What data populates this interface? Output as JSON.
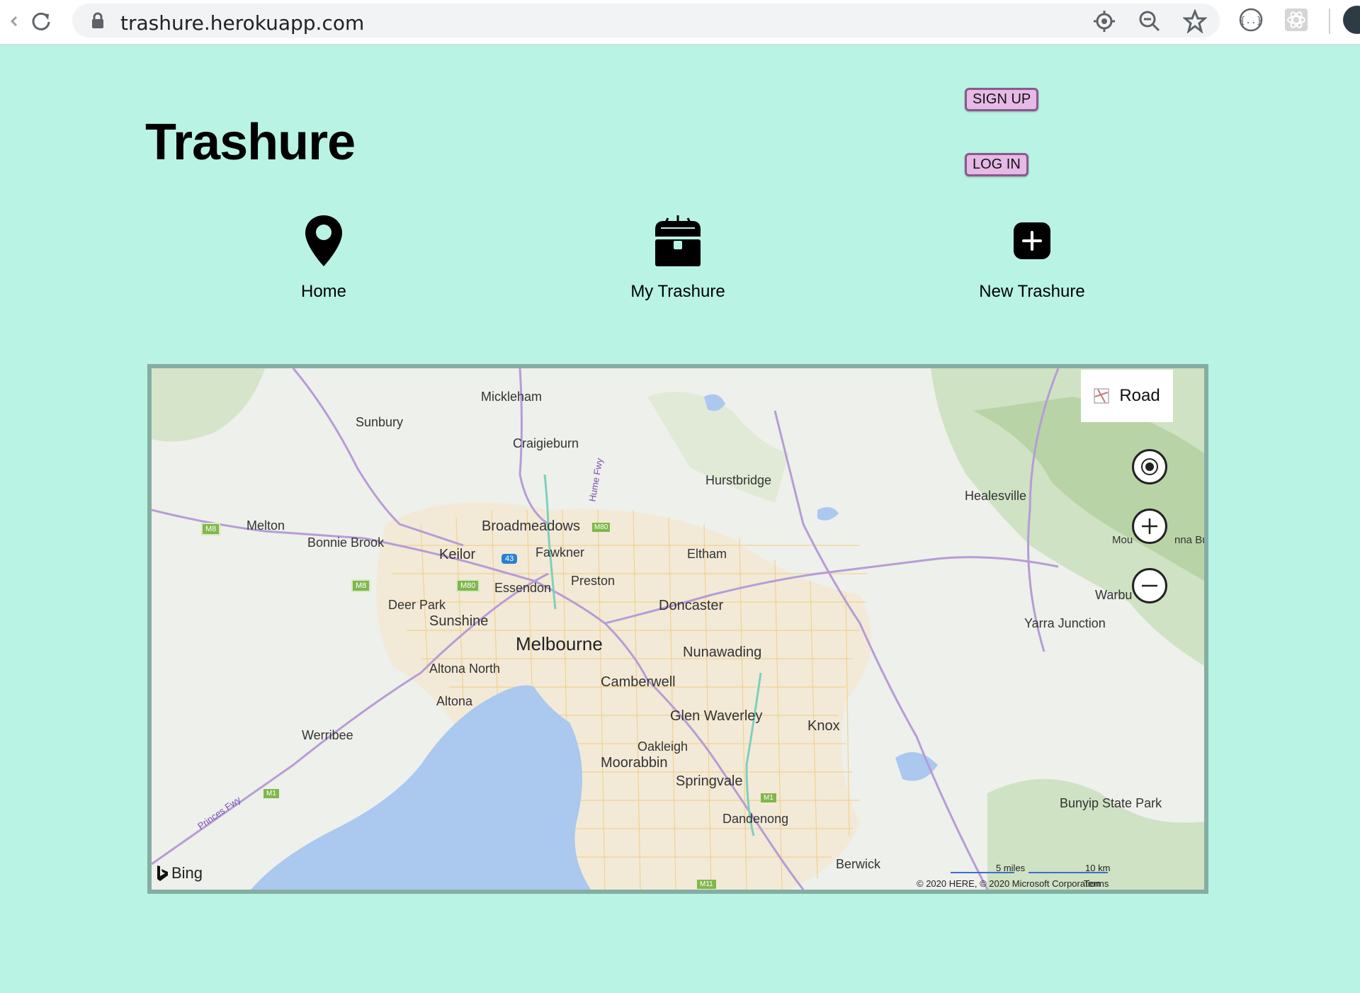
{
  "browser": {
    "url": "trashure.herokuapp.com"
  },
  "header": {
    "title": "Trashure",
    "signup_label": "SIGN UP",
    "login_label": "LOG IN"
  },
  "nav": {
    "items": [
      {
        "label": "Home",
        "icon": "map-pin-icon"
      },
      {
        "label": "My Trashure",
        "icon": "treasure-chest-icon"
      },
      {
        "label": "New Trashure",
        "icon": "plus-square-icon"
      }
    ]
  },
  "map": {
    "style_button": "Road",
    "places": {
      "mickleham": "Mickleham",
      "sunbury": "Sunbury",
      "craigieburn": "Craigieburn",
      "hurstbridge": "Hurstbridge",
      "healesville": "Healesville",
      "melton": "Melton",
      "bonnie_brook": "Bonnie Brook",
      "broadmeadows": "Broadmeadows",
      "keilor": "Keilor",
      "fawkner": "Fawkner",
      "eltham": "Eltham",
      "preston": "Preston",
      "essendon": "Essendon",
      "deer_park": "Deer Park",
      "doncaster": "Doncaster",
      "sunshine": "Sunshine",
      "melbourne": "Melbourne",
      "nunawading": "Nunawading",
      "altona_north": "Altona North",
      "camberwell": "Camberwell",
      "altona": "Altona",
      "glen_waverley": "Glen Waverley",
      "knox": "Knox",
      "werribee": "Werribee",
      "oakleigh": "Oakleigh",
      "moorabbin": "Moorabbin",
      "springvale": "Springvale",
      "dandenong": "Dandenong",
      "berwick": "Berwick",
      "bunyip": "Bunyip State Park",
      "yarra_junction": "Yarra Junction",
      "warbu": "Warbu",
      "mou": "Mou",
      "nna_bu": "nna Bu",
      "hume_fwy": "Hume Fwy",
      "princes_fwy": "Princes Fwy"
    },
    "shields": [
      "M8",
      "M8",
      "M80",
      "M80",
      "43",
      "M1",
      "M1",
      "M11"
    ],
    "scale_miles": "5 miles",
    "scale_km": "10 km",
    "brand": "Bing",
    "copyright": "© 2020 HERE, © 2020 Microsoft Corporation",
    "terms": "Terms"
  },
  "colors": {
    "page_bg": "#b9f3e4",
    "auth_button_bg": "#e6b9e6",
    "map_water": "#abc8ef",
    "map_land": "#eef0eb"
  }
}
